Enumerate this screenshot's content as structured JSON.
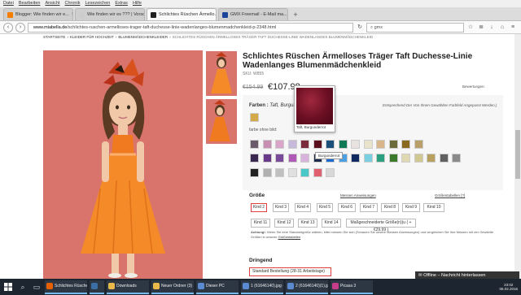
{
  "menu": [
    "Datei",
    "Bearbeiten",
    "Ansicht",
    "Chronik",
    "Lesezeichen",
    "Extras",
    "Hilfe"
  ],
  "tabs": [
    {
      "label": "Blogger: Wie finden wir e...",
      "color": "#f57d00",
      "active": false
    },
    {
      "label": "Wie finden wir es ??? | Vorsche...",
      "color": "#cccccc",
      "active": false
    },
    {
      "label": "Schlichtes Rüschen Ärmello...",
      "color": "#222222",
      "active": true
    },
    {
      "label": "GMX Freemail - E-Mail ma...",
      "color": "#1c449b",
      "active": false
    }
  ],
  "nav": {
    "url_domain": "www.miabella.de",
    "url_path": "/schlichtes-ruschen-armelloses-trager-taft-duchesse-linie-wadenlanges-blumenmadchenkleid-p-2348.html",
    "search_value": "gmx"
  },
  "breadcrumb": [
    "STARTSEITE",
    "KLEIDER FÜR HOCHZEIT",
    "BLUMENMÄDCHENKLEIDER",
    "SCHLICHTES RÜSCHEN ÄRMELLOSES TRÄGER TAFT DUCHESSE-LINIE WADENLANGES BLUMENMÄDCHENKLEID"
  ],
  "product": {
    "title": "Schlichtes Rüschen Ärmelloses Träger Taft Duchesse-Linie Wadenlanges Blumenmädchenkleid",
    "sku": "SKU: W855",
    "price_old": "€154.99",
    "price": "€107.98",
    "reviews": "Bewertungen:"
  },
  "colors": {
    "label": "Farben :",
    "selected": "Taft, Burgund",
    "note": "Entsprechend Der Von Ihnen Gewählten Farbfeld Angepasst Werden.)",
    "without_image_label": "farbe ohne bild:",
    "popup_caption": "Taft, Burgunderrot",
    "tooltip": "Burgunderrot",
    "top_swatch": "#d4a94a",
    "row1": [
      "#6b5a6a",
      "#c98fb3",
      "#d9a6c9",
      "#c7b9d9",
      "#7a2a3a",
      "#5a0f1e",
      "#1a4f7a",
      "#0f7a55",
      "#e8e2e0",
      "#e9e3cc",
      "#d8b58b",
      "#6b6b3a",
      "#8a6a1e",
      "#b9a06a"
    ],
    "row2": [
      "#3a2850",
      "#6a3a8a",
      "#7a4a9a",
      "#b05ab8",
      "#d8b4dc",
      "#1a2a4a",
      "#1a6ad0",
      "#4aa0e0",
      "#0f2a60",
      "#7ad0e0",
      "#2aa080",
      "#3a7a2a",
      "#e0d8b0",
      "#d0c890",
      "#b8a060",
      "#606060",
      "#8a8a8a"
    ],
    "row3": [
      "#222222",
      "#b0b0b0",
      "#c0c0c0",
      "#e0e0e0",
      "#4ac8c8",
      "#e06070",
      "#d8d8d8"
    ]
  },
  "size": {
    "heading": "Größe",
    "measure_link": "Messen Anweisungen",
    "table_link": "Größentabellen [?]",
    "options": [
      "Kind 2",
      "Kind 3",
      "Kind 4",
      "Kind 5",
      "Kind 6",
      "Kind 7",
      "Kind 8",
      "Kind 9",
      "Kind 10",
      "Kind 11",
      "Kind 12",
      "Kind 13",
      "Kind 14"
    ],
    "custom": "Maßgeschneiderte Größe(n)(u ( +€29.99 )",
    "selected": "Kind 2",
    "note_bold": "Achtung!:",
    "note_text": "Wenn Sie eine Standardgröße wählen, bitte messen Sie sich (Schauen Sie unsere Messen Anweisungen) und vergleichen Sie Ihre Messen mit der Gewählte Größen in unserer",
    "note_link": "Größentabellen"
  },
  "urgent": {
    "heading": "Dringend",
    "option": "Standard Bestellung (28-31 Arbeitstage)"
  },
  "notification": "Offline – Nachricht hinterlassen",
  "taskbar": {
    "apps": [
      {
        "label": "Schlichtes Rüschen...",
        "color": "#e66000"
      },
      {
        "label": "",
        "color": "#3a6ea5"
      },
      {
        "label": "Downloads",
        "color": "#e8b84a"
      },
      {
        "label": "Neuer Ordner (3)",
        "color": "#e8b84a"
      },
      {
        "label": "Dieser PC",
        "color": "#5a8ad0"
      },
      {
        "label": "1 (61646140).jpg - ...",
        "color": "#5a8ad0"
      },
      {
        "label": "2 (61646140)(1).jpg ...",
        "color": "#5a8ad0"
      },
      {
        "label": "Picasa 3",
        "color": "#c83c8a"
      }
    ],
    "time": "23:02",
    "date": "06.02.2016"
  }
}
